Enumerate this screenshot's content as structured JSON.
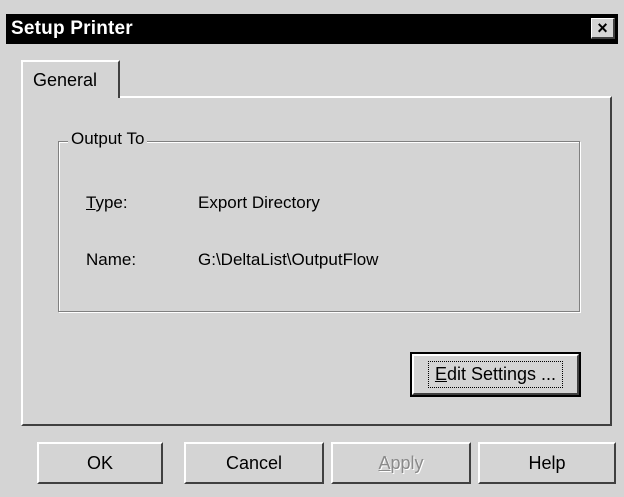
{
  "window": {
    "title": "Setup Printer",
    "close_glyph": "×"
  },
  "tabs": [
    {
      "label": "General"
    }
  ],
  "output_group": {
    "legend": "Output To",
    "type_label_mnemonic": "T",
    "type_label_rest": "ype:",
    "type_value": "Export Directory",
    "name_label": "Name:",
    "name_value": "G:\\DeltaList\\OutputFlow"
  },
  "edit_settings": {
    "mnemonic": "E",
    "rest": "dit Settings ..."
  },
  "buttons": {
    "ok": "OK",
    "cancel": "Cancel",
    "apply_mnemonic": "A",
    "apply_rest": "pply",
    "help": "Help"
  }
}
